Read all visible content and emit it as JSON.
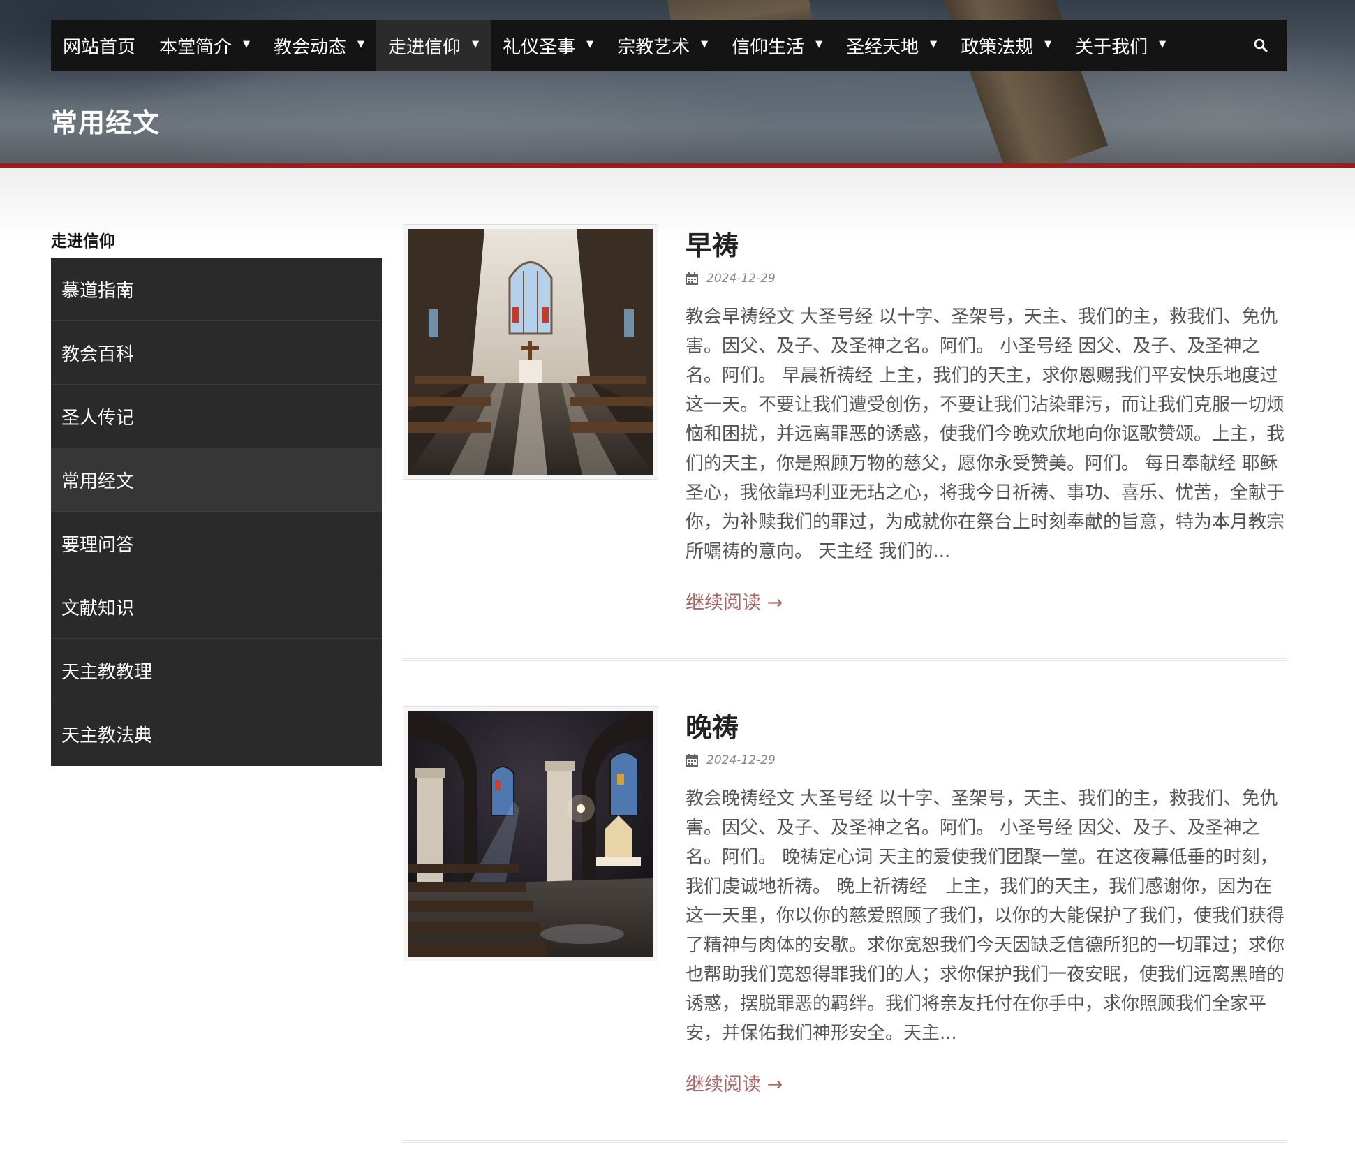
{
  "nav": {
    "items": [
      {
        "label": "网站首页",
        "has_caret": false
      },
      {
        "label": "本堂简介",
        "has_caret": true
      },
      {
        "label": "教会动态",
        "has_caret": true
      },
      {
        "label": "走进信仰",
        "has_caret": true
      },
      {
        "label": "礼仪圣事",
        "has_caret": true
      },
      {
        "label": "宗教艺术",
        "has_caret": true
      },
      {
        "label": "信仰生活",
        "has_caret": true
      },
      {
        "label": "圣经天地",
        "has_caret": true
      },
      {
        "label": "政策法规",
        "has_caret": true
      },
      {
        "label": "关于我们",
        "has_caret": true
      }
    ],
    "active_index": 3,
    "search_icon": "search-icon"
  },
  "page": {
    "title": "常用经文"
  },
  "sidebar": {
    "title": "走进信仰",
    "items": [
      {
        "label": "慕道指南"
      },
      {
        "label": "教会百科"
      },
      {
        "label": "圣人传记"
      },
      {
        "label": "常用经文"
      },
      {
        "label": "要理问答"
      },
      {
        "label": "文献知识"
      },
      {
        "label": "天主教教理"
      },
      {
        "label": "天主教法典"
      }
    ],
    "active_index": 3
  },
  "posts": [
    {
      "title": "早祷",
      "date": "2024-12-29",
      "excerpt": "教会早祷经文 大圣号经 以十字、圣架号，天主、我们的主，救我们、免仇害。因父、及子、及圣神之名。阿们。 小圣号经 因父、及子、及圣神之名。阿们。 早晨祈祷经 上主，我们的天主，求你恩赐我们平安快乐地度过这一天。不要让我们遭受创伤，不要让我们沾染罪污，而让我们克服一切烦恼和困扰，并远离罪恶的诱惑，使我们今晚欢欣地向你讴歌赞颂。上主，我们的天主，你是照顾万物的慈父，愿你永受赞美。阿们。 每日奉献经 耶稣圣心，我依靠玛利亚无玷之心，将我今日祈祷、事功、喜乐、忧苦，全献于你，为补赎我们的罪过，为成就你在祭台上时刻奉献的旨意，特为本月教宗所嘱祷的意向。 天主经 我们的...",
      "read_more": "继续阅读 →"
    },
    {
      "title": "晚祷",
      "date": "2024-12-29",
      "excerpt": "教会晚祷经文 大圣号经 以十字、圣架号，天主、我们的主，救我们、免仇害。因父、及子、及圣神之名。阿们。 小圣号经 因父、及子、及圣神之名。阿们。 晚祷定心词 天主的爱使我们团聚一堂。在这夜幕低垂的时刻，我们虔诚地祈祷。 晚上祈祷经　上主，我们的天主，我们感谢你，因为在这一天里，你以你的慈爱照顾了我们，以你的大能保护了我们，使我们获得了精神与肉体的安歇。求你宽恕我们今天因缺乏信德所犯的一切罪过；求你也帮助我们宽恕得罪我们的人；求你保护我们一夜安眠，使我们远离黑暗的诱惑，摆脱罪恶的羁绊。我们将亲友托付在你手中，求你照顾我们全家平安，并保佑我们神形安全。天主...",
      "read_more": "继续阅读 →"
    }
  ],
  "colors": {
    "nav_bg": "#141414",
    "accent_red": "#9d1d1d",
    "read_more": "#a86565",
    "sidebar_bg": "#2a2a2a"
  }
}
